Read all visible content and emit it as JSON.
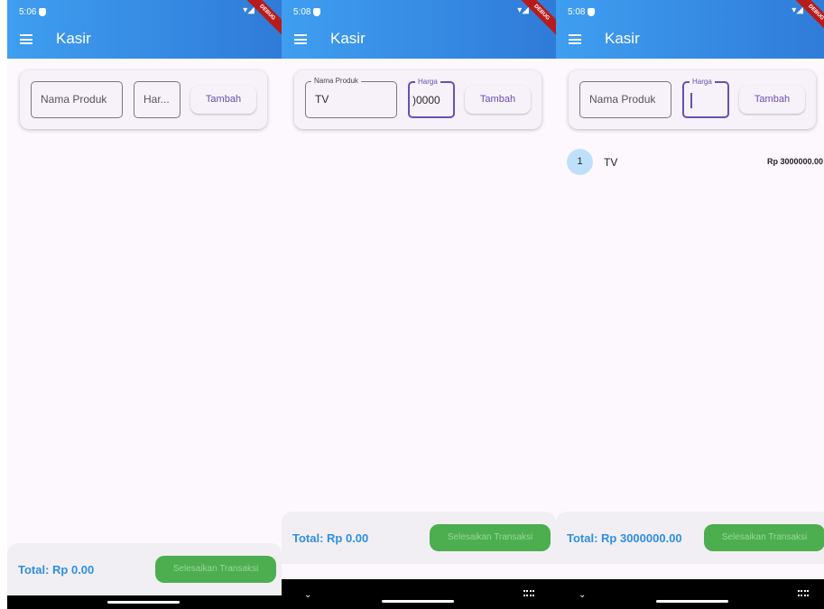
{
  "app": {
    "title": "Kasir",
    "accent": "#2f7bd8",
    "debug_banner": "DEBUG"
  },
  "screens": [
    {
      "status_time": "5:06",
      "fields": {
        "name": {
          "text": "Nama Produk"
        },
        "price": {
          "text": "Har..."
        }
      },
      "add_button": "Tambah",
      "total": "Total: Rp 0.00",
      "finish_button": "Selesaikan Transaksi"
    },
    {
      "status_time": "5:08",
      "fields": {
        "name": {
          "label": "Nama Produk",
          "value": "TV"
        },
        "price": {
          "label": "Harga",
          "value": ")0000"
        }
      },
      "add_button": "Tambah",
      "total": "Total: Rp 0.00",
      "finish_button": "Selesaikan Transaksi"
    },
    {
      "status_time": "5:08",
      "fields": {
        "name": {
          "text": "Nama Produk"
        },
        "price": {
          "label": "Harga",
          "value": ""
        }
      },
      "add_button": "Tambah",
      "items": [
        {
          "index": "1",
          "name": "TV",
          "price": "Rp 3000000.00"
        }
      ],
      "total": "Total: Rp 3000000.00",
      "finish_button": "Selesaikan Transaksi"
    }
  ]
}
